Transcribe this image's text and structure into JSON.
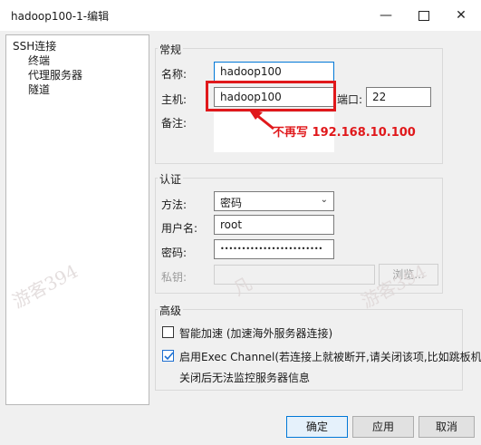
{
  "window": {
    "title": "hadoop100-1-编辑"
  },
  "tree": {
    "items": [
      {
        "label": "SSH连接",
        "level": 0
      },
      {
        "label": "终端",
        "level": 1
      },
      {
        "label": "代理服务器",
        "level": 1
      },
      {
        "label": "隧道",
        "level": 1
      }
    ]
  },
  "general": {
    "title": "常规",
    "name_label": "名称:",
    "name_value": "hadoop100",
    "host_label": "主机:",
    "host_value": "hadoop100",
    "port_label": "端口:",
    "port_value": "22",
    "note_label": "备注:"
  },
  "annotation": {
    "text": "不再写 192.168.10.100",
    "color": "#e0181b"
  },
  "auth": {
    "title": "认证",
    "method_label": "方法:",
    "method_value": "密码",
    "user_label": "用户名:",
    "user_value": "root",
    "password_label": "密码:",
    "password_value": "••••••••••••••••••••••••",
    "key_label": "私钥:",
    "browse_label": "浏览..."
  },
  "advanced": {
    "title": "高级",
    "smart_accel_label": "智能加速 (加速海外服务器连接)",
    "smart_accel_checked": false,
    "exec_channel_label": "启用Exec Channel(若连接上就被断开,请关闭该项,比如跳板机)",
    "exec_channel_checked": true,
    "exec_channel_note": "关闭后无法监控服务器信息"
  },
  "footer": {
    "ok_label": "确定",
    "apply_label": "应用",
    "cancel_label": "取消"
  },
  "watermarks": [
    "游客394",
    "凡",
    "游客394"
  ]
}
